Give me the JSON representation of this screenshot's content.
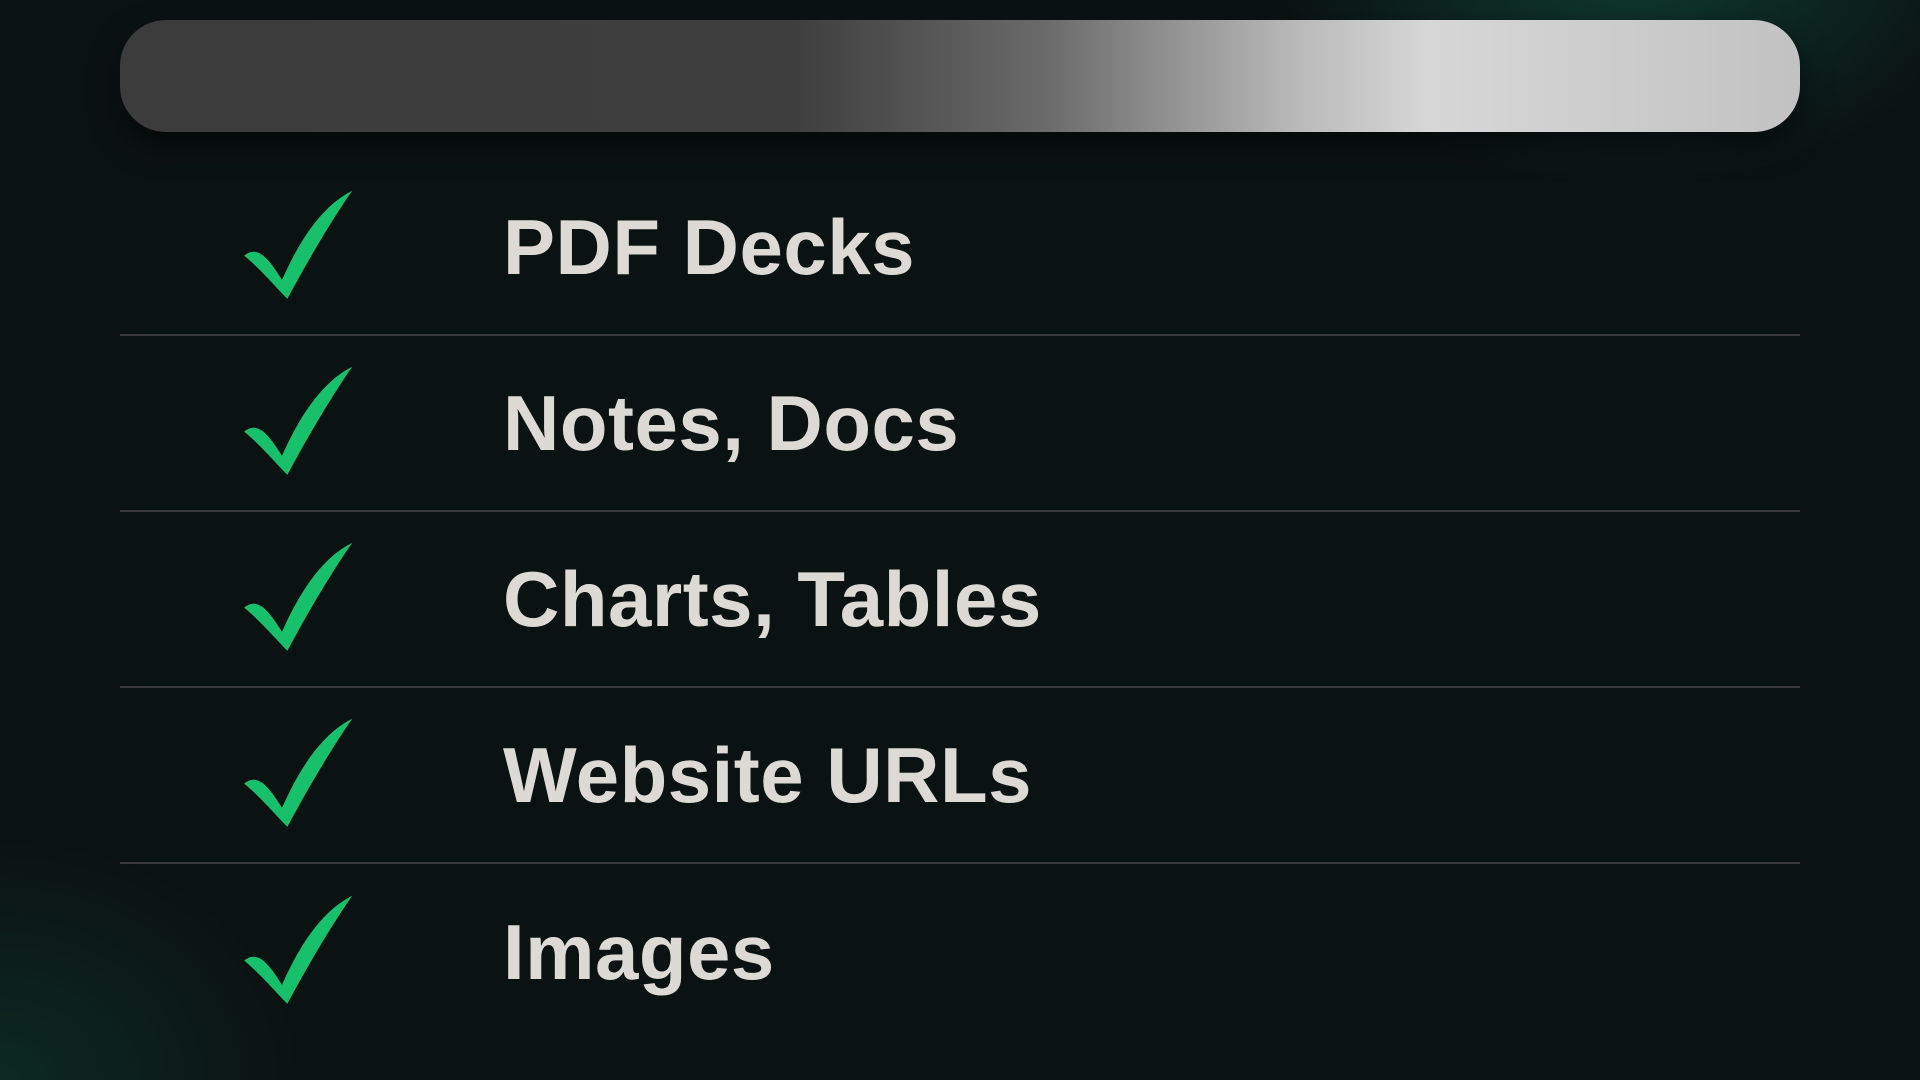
{
  "colors": {
    "check": "#18c06b",
    "text": "#dddad6",
    "divider": "#3a3c3b"
  },
  "items": [
    {
      "label": "PDF Decks"
    },
    {
      "label": "Notes, Docs"
    },
    {
      "label": "Charts, Tables"
    },
    {
      "label": "Website URLs"
    },
    {
      "label": "Images"
    }
  ]
}
